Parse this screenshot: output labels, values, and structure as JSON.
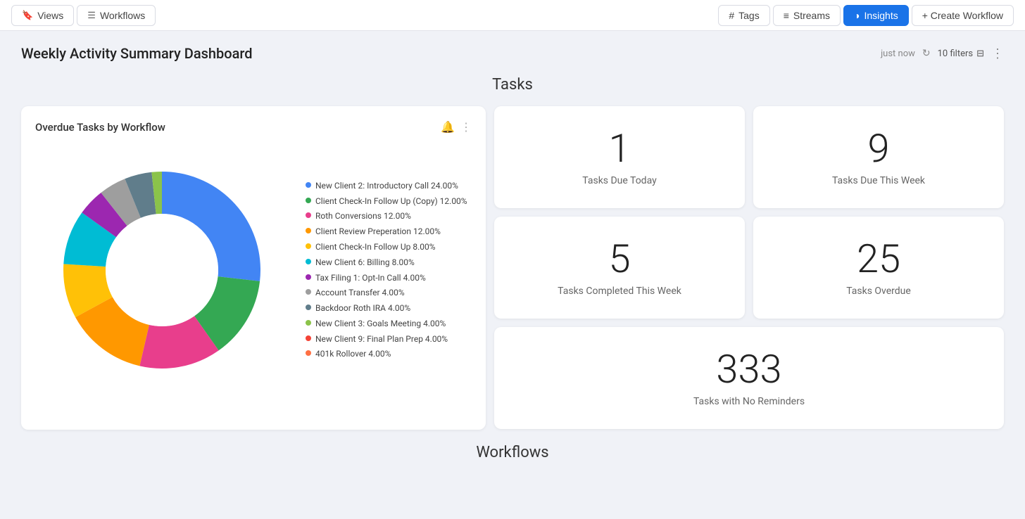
{
  "topnav": {
    "views_label": "Views",
    "workflows_label": "Workflows",
    "tags_label": "Tags",
    "streams_label": "Streams",
    "insights_label": "Insights",
    "create_workflow_label": "+ Create Workflow"
  },
  "dashboard": {
    "title": "Weekly Activity Summary Dashboard",
    "last_updated": "just now",
    "filters": "10 filters"
  },
  "tasks_section": {
    "title": "Tasks",
    "chart": {
      "title": "Overdue Tasks by Workflow"
    },
    "legend": [
      {
        "label": "New Client 2: Introductory Call 24.00%",
        "color": "#4285f4"
      },
      {
        "label": "Client Check-In Follow Up (Copy) 12.00%",
        "color": "#34a853"
      },
      {
        "label": "Roth Conversions 12.00%",
        "color": "#e83e8c"
      },
      {
        "label": "Client Review Preperation 12.00%",
        "color": "#ff9800"
      },
      {
        "label": "Client Check-In Follow Up 8.00%",
        "color": "#ffc107"
      },
      {
        "label": "New Client 6: Billing 8.00%",
        "color": "#00bcd4"
      },
      {
        "label": "Tax Filing 1: Opt-In Call 4.00%",
        "color": "#9c27b0"
      },
      {
        "label": "Account Transfer 4.00%",
        "color": "#9e9e9e"
      },
      {
        "label": "Backdoor Roth IRA 4.00%",
        "color": "#607d8b"
      },
      {
        "label": "New Client 3: Goals Meeting 4.00%",
        "color": "#8bc34a"
      },
      {
        "label": "New Client 9: Final Plan Prep 4.00%",
        "color": "#f44336"
      },
      {
        "label": "401k Rollover 4.00%",
        "color": "#ff7043"
      }
    ],
    "stats": {
      "due_today_count": "1",
      "due_today_label": "Tasks Due Today",
      "due_week_count": "9",
      "due_week_label": "Tasks Due This Week",
      "completed_week_count": "5",
      "completed_week_label": "Tasks Completed This Week",
      "overdue_count": "25",
      "overdue_label": "Tasks Overdue",
      "no_reminders_count": "333",
      "no_reminders_label": "Tasks with No Reminders"
    }
  },
  "workflows_section": {
    "title": "Workflows"
  }
}
